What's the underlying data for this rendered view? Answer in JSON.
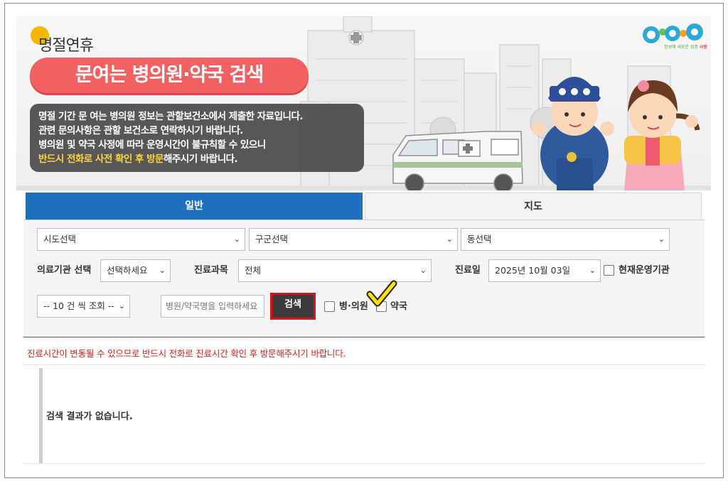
{
  "banner": {
    "subtitle": "명절연휴",
    "title": "문여는 병의원·약국 검색",
    "notice_lines": [
      "명절 기간 문 여는 병의원 정보는 관할보건소에서 제출한 자료입니다.",
      "관련 문의사항은 관할 보건소로 연락하시기 바랍니다.",
      "병의원 및 약국 사정에 따라 운영시간이 불규칙할 수 있으니"
    ],
    "notice_highlight": "반드시 전화로 사전 확인 후 방문",
    "notice_tail": "해주시기 바랍니다.",
    "logo_text_a": "정성",
    "logo_text_b": "에 새로운 집중 ",
    "logo_text_c": "사랑",
    "colors": {
      "pill": "#f26161",
      "highlight": "#ffd43b"
    }
  },
  "tabs": [
    {
      "label": "일반",
      "active": true
    },
    {
      "label": "지도",
      "active": false
    }
  ],
  "filters": {
    "sido": "시도선택",
    "gugun": "구군선택",
    "dong": "동선택",
    "institution_label": "의료기관 선택",
    "institution_value": "선택하세요",
    "department_label": "진료과목",
    "department_value": "전체",
    "date_label": "진료일",
    "date_value": "2025년 10월 03일",
    "open_now_label": "현재운영기관",
    "page_size": "-- 10 건 씩 조회 --",
    "name_placeholder": "병원/약국명을 입력하세요",
    "search_button": "검색",
    "type_hospital": "병·의원",
    "type_pharmacy": "약국"
  },
  "warning": "진료시간이 변동될 수 있으므로 반드시 전화로 진료시간 확인 후 방문해주시기 바랍니다.",
  "result_message": "검색 결과가 없습니다.",
  "icons": {
    "arrow": "chevron-down-icon",
    "check": "check-mark-icon"
  }
}
